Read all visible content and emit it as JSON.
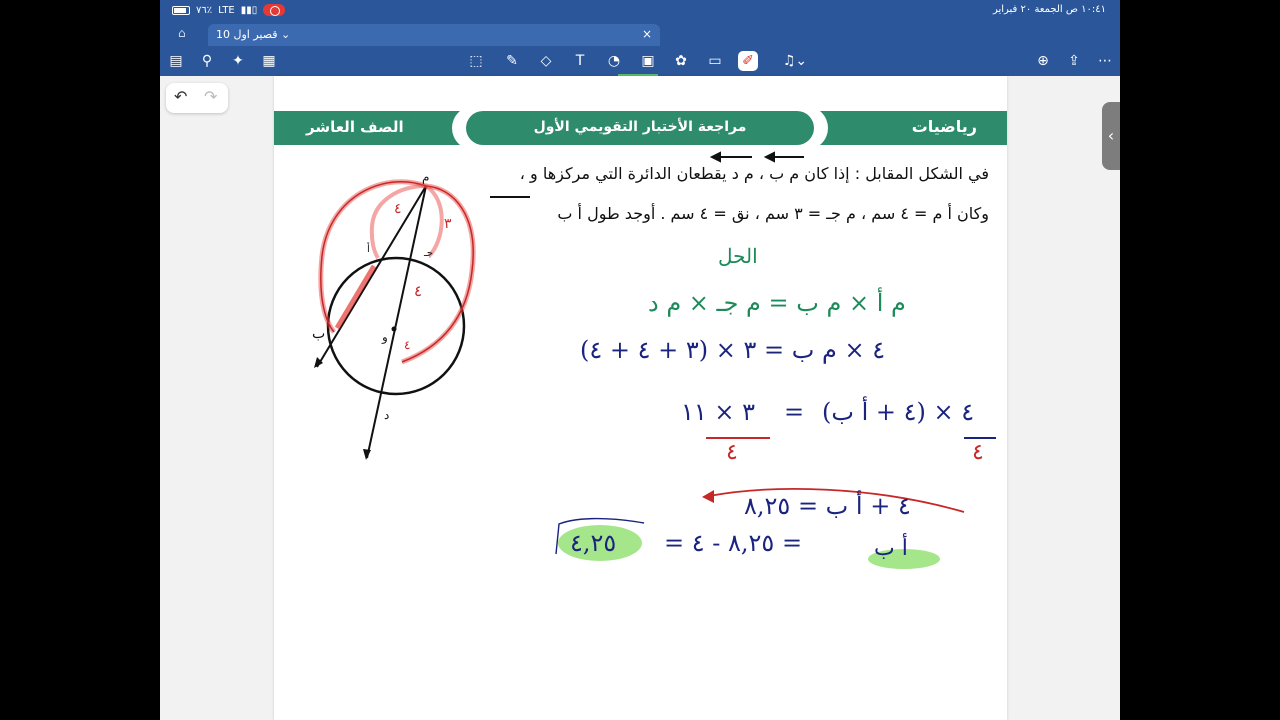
{
  "status_bar": {
    "time_date": "١٠:٤١ ص  الجمعة ٢٠ فبراير",
    "battery": "٧٦٪",
    "network": "LTE"
  },
  "tab": {
    "title": "قصير اول 10",
    "chevron": "⌄",
    "close": "×"
  },
  "toolbar": {
    "icons": [
      "book-icon",
      "search-icon",
      "magic-icon",
      "notebook-icon",
      "lasso-icon",
      "pen-icon",
      "eraser-icon",
      "text-icon",
      "shapes-icon",
      "image-icon",
      "stickers-icon",
      "sticky-note-icon",
      "highlighter-icon",
      "mic-icon",
      "new-page-icon",
      "share-icon",
      "more-icon"
    ]
  },
  "header": {
    "subject": "رياضيات",
    "title": "مراجعة الأختبار التقويمي الأول",
    "grade": "الصف العاشر"
  },
  "question": {
    "line1": "في الشكل المقابل : إذا كان م ب ،  م د  يقطعان الدائرة التي مركزها و ،",
    "line2": "وكان أ م = ٤ سم ، م جـ = ٣ سم ، نق = ٤ سم  .  أوجد طول أ ب"
  },
  "figure_labels": {
    "m": "م",
    "b": "ب",
    "d": "د",
    "o": "و",
    "a": "أ",
    "j": "جـ",
    "four_a": "٤",
    "four_b": "٤",
    "three": "٣",
    "four_radius": "٤"
  },
  "solution": {
    "heading": "الحل",
    "line1": "م أ × م ب = م جـ × م د",
    "line2": "٤ × م ب = ٣ × (٣ + ٤ + ٤)",
    "line3_left": "٣ × ١١",
    "line3_right": "٤ × (٤ + أ ب)",
    "line3_den_left": "٤",
    "line3_den_right": "٤",
    "line4": "٤ + أ ب = ٨,٢٥",
    "line5_left": "٤,٢٥",
    "line5_mid": "= ٨,٢٥ - ٤ =",
    "line5_right": "أ ب"
  },
  "colors": {
    "office_blue": "#2b579a",
    "band_green": "#2e8b6b",
    "ink_navy": "#1a237e",
    "ink_green": "#1e8a5a",
    "ink_red": "#d32f2f",
    "highlight": "#8fe06e"
  }
}
